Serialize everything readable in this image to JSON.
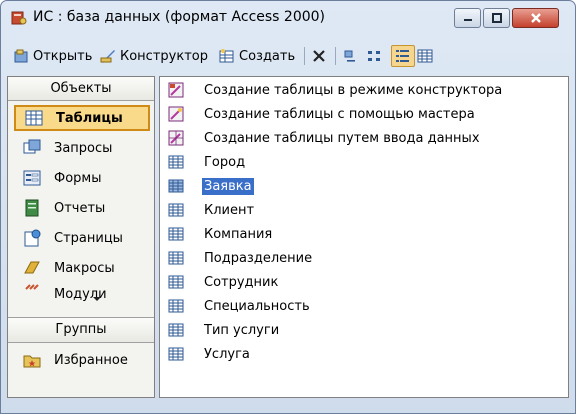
{
  "window": {
    "title": "ИС : база данных (формат Access 2000)",
    "icon": "database-key-icon",
    "accent": "#3a6fc9"
  },
  "toolbar": {
    "open_label": "Открыть",
    "design_label": "Конструктор",
    "create_label": "Создать",
    "view_mode_selected": "details"
  },
  "objects": {
    "header": "Объекты",
    "items": [
      {
        "label": "Таблицы",
        "icon": "table-icon",
        "selected": true
      },
      {
        "label": "Запросы",
        "icon": "query-icon"
      },
      {
        "label": "Формы",
        "icon": "form-icon"
      },
      {
        "label": "Отчеты",
        "icon": "report-icon"
      },
      {
        "label": "Страницы",
        "icon": "page-icon"
      },
      {
        "label": "Макросы",
        "icon": "macro-icon"
      },
      {
        "label": "Модули",
        "icon": "module-icon"
      }
    ],
    "groups_header": "Группы",
    "groups": [
      {
        "label": "Избранное",
        "icon": "favorites-folder-icon"
      }
    ]
  },
  "list": {
    "items": [
      {
        "label": "Создание таблицы в режиме конструктора",
        "icon": "create-table-design-icon"
      },
      {
        "label": "Создание таблицы с помощью мастера",
        "icon": "create-table-wizard-icon"
      },
      {
        "label": "Создание таблицы путем ввода данных",
        "icon": "create-table-data-icon"
      },
      {
        "label": "Город",
        "icon": "table-icon"
      },
      {
        "label": "Заявка",
        "icon": "table-icon",
        "selected": true
      },
      {
        "label": "Клиент",
        "icon": "table-icon"
      },
      {
        "label": "Компания",
        "icon": "table-icon"
      },
      {
        "label": "Подразделение",
        "icon": "table-icon"
      },
      {
        "label": "Сотрудник",
        "icon": "table-icon"
      },
      {
        "label": "Специальность",
        "icon": "table-icon"
      },
      {
        "label": "Тип услуги",
        "icon": "table-icon"
      },
      {
        "label": "Услуга",
        "icon": "table-icon"
      }
    ]
  }
}
